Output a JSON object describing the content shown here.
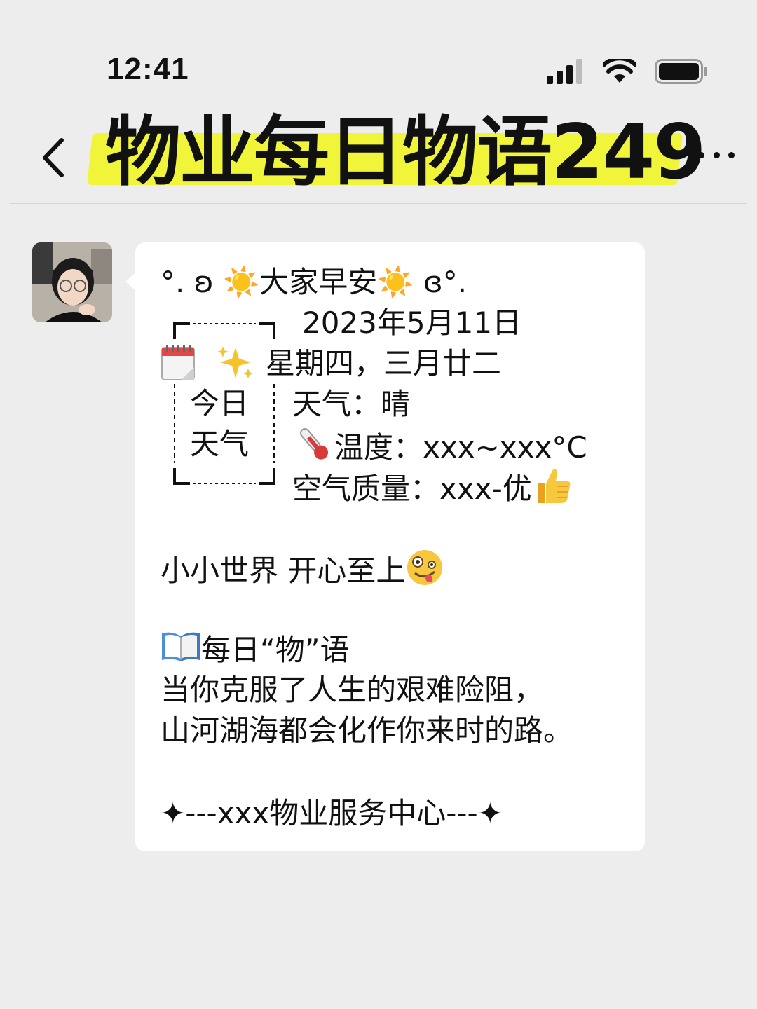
{
  "status_bar": {
    "time": "12:41"
  },
  "nav": {
    "title": "物业每日物语249",
    "highlight_color": "#f1f53a"
  },
  "message": {
    "greeting": "°. ʚ ☀️大家早安☀️ ɞ°.",
    "date": "2023年5月11日",
    "weekday_lunar": "星期四，三月廿二",
    "frame_line1": "今日",
    "frame_line2": "天气",
    "weather": "天气：晴",
    "temperature": "温度：xxx~xxx°C",
    "air_quality": "空气质量：xxx-优",
    "motto": "小小世界 开心至上",
    "daily_heading": "每日“物”语",
    "quote_line1": "当你克服了人生的艰难险阻，",
    "quote_line2": "山河湖海都会化作你来时的路。",
    "signature": "✦---xxx物业服务中心---✦"
  },
  "icons": {
    "back": "back-chevron-icon",
    "more": "more-dots-icon",
    "signal": "signal-icon",
    "wifi": "wifi-icon",
    "battery": "battery-icon",
    "calendar": "calendar-icon",
    "sparkles": "sparkles-icon",
    "thermometer": "thermometer-icon",
    "thumbs_up": "thumbs-up-icon",
    "zany_face": "zany-face-icon",
    "book": "open-book-icon"
  }
}
